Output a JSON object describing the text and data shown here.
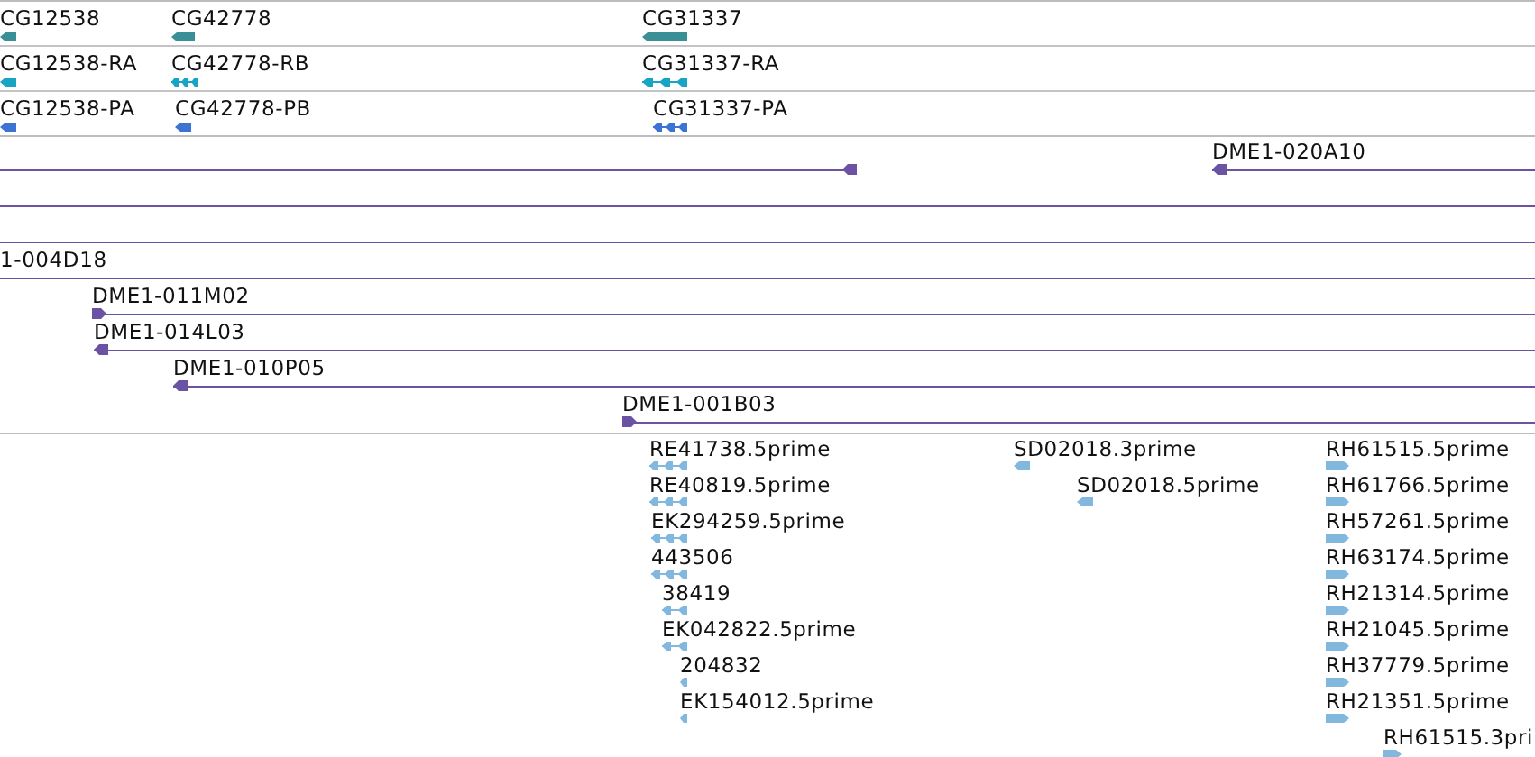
{
  "tracks": [
    {
      "kind": "gene",
      "rows": [
        {
          "kind": "gene",
          "features": [
            {
              "label": "CG12538",
              "reverse": true
            },
            {
              "label": "CG42778",
              "reverse": true
            },
            {
              "label": "CG31337",
              "reverse": true
            }
          ]
        },
        {
          "kind": "mrna",
          "features": [
            {
              "label": "CG12538-RA",
              "reverse": true
            },
            {
              "label": "CG42778-RB",
              "reverse": true
            },
            {
              "label": "CG31337-RA",
              "reverse": true
            }
          ]
        },
        {
          "kind": "cds",
          "features": [
            {
              "label": "CG12538-PA",
              "reverse": true
            },
            {
              "label": "CG42778-PB",
              "reverse": true
            },
            {
              "label": "CG31337-PA",
              "reverse": true
            }
          ]
        }
      ]
    },
    {
      "kind": "clone",
      "rows": [
        {
          "features": [
            {
              "kind": "clone",
              "reverse": true
            },
            {
              "kind": "clone",
              "label": "DME1-020A10",
              "reverse": true
            }
          ]
        },
        {
          "features": [
            {
              "kind": "span"
            }
          ]
        },
        {
          "features": [
            {
              "kind": "span"
            }
          ]
        },
        {
          "features": [
            {
              "kind": "span",
              "label": "1-004D18"
            }
          ]
        },
        {
          "features": [
            {
              "kind": "clone",
              "label": "DME1-011M02",
              "reverse": false
            }
          ]
        },
        {
          "features": [
            {
              "kind": "clone",
              "label": "DME1-014L03",
              "reverse": true
            }
          ]
        },
        {
          "features": [
            {
              "kind": "clone",
              "label": "DME1-010P05",
              "reverse": true
            }
          ]
        },
        {
          "features": [
            {
              "kind": "clone",
              "label": "DME1-001B03",
              "reverse": false
            }
          ]
        }
      ]
    },
    {
      "kind": "est",
      "rows": [
        {
          "features": [
            {
              "label": "RE41738.5prime",
              "reverse": true
            },
            {
              "label": "SD02018.3prime",
              "reverse": true
            },
            {
              "label": "RH61515.5prime",
              "reverse": false
            }
          ]
        },
        {
          "features": [
            {
              "label": "RE40819.5prime",
              "reverse": true
            },
            {
              "label": "SD02018.5prime",
              "reverse": true
            },
            {
              "label": "RH61766.5prime",
              "reverse": false
            }
          ]
        },
        {
          "features": [
            {
              "label": "EK294259.5prime",
              "reverse": true
            },
            {
              "label": "RH57261.5prime",
              "reverse": false
            }
          ]
        },
        {
          "features": [
            {
              "label": "443506",
              "reverse": true
            },
            {
              "label": "RH63174.5prime",
              "reverse": false
            }
          ]
        },
        {
          "features": [
            {
              "label": "38419",
              "reverse": true
            },
            {
              "label": "RH21314.5prime",
              "reverse": false
            }
          ]
        },
        {
          "features": [
            {
              "label": "EK042822.5prime",
              "reverse": true
            },
            {
              "label": "RH21045.5prime",
              "reverse": false
            }
          ]
        },
        {
          "features": [
            {
              "label": "204832",
              "reverse": true
            },
            {
              "label": "RH37779.5prime",
              "reverse": false
            }
          ]
        },
        {
          "features": [
            {
              "label": "EK154012.5prime",
              "reverse": true
            },
            {
              "label": "RH21351.5prime",
              "reverse": false
            }
          ]
        },
        {
          "features": [
            {
              "label": "RH61515.3pri",
              "reverse": false
            }
          ]
        }
      ]
    }
  ]
}
